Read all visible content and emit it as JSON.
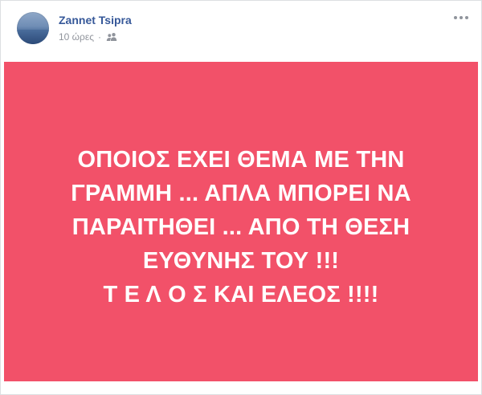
{
  "post": {
    "author": {
      "name": "Zannet Tsipra",
      "avatar_icon": "profile-photo"
    },
    "timestamp": "10 ώρες",
    "separator": "·",
    "audience_icon": "friends-icon",
    "options_icon": "more-options-icon",
    "background_color": "#f25169",
    "text_lines": [
      "ΟΠΟΙΟΣ ΕΧΕΙ ΘΕΜΑ ΜΕ ΤΗΝ",
      "ΓΡΑΜΜΗ ... ΑΠΛΑ ΜΠΟΡΕΙ ΝΑ",
      "ΠΑΡΑΙΤΗΘΕΙ ... ΑΠΟ ΤΗ ΘΕΣΗ",
      "ΕΥΘΥΝΗΣ ΤΟΥ !!!",
      "Τ Ε Λ Ο Σ ΚΑΙ ΕΛΕΟΣ !!!!"
    ]
  }
}
